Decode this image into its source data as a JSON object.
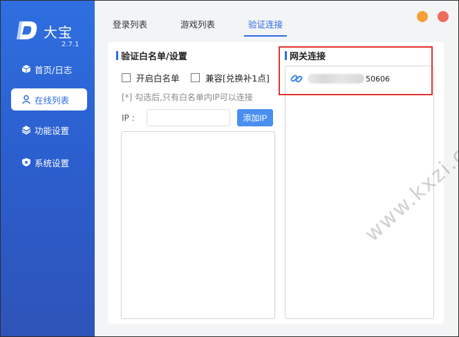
{
  "app": {
    "name": "大宝",
    "version": "2.7.1"
  },
  "sidebar": {
    "items": [
      {
        "label": "首页/日志",
        "icon": "cube-icon",
        "active": false
      },
      {
        "label": "在线列表",
        "icon": "user-icon",
        "active": true
      },
      {
        "label": "功能设置",
        "icon": "layers-icon",
        "active": false
      },
      {
        "label": "系统设置",
        "icon": "shield-icon",
        "active": false
      }
    ]
  },
  "tabs": [
    {
      "label": "登录列表",
      "active": false
    },
    {
      "label": "游戏列表",
      "active": false
    },
    {
      "label": "验证连接",
      "active": true
    }
  ],
  "whitelist": {
    "title": "验证白名单/设置",
    "enable_label": "开启白名单",
    "compat_label": "兼容[兑换补1点]",
    "hint": "[*] 勾选后,只有白名单内IP可以连接",
    "ip_label": "IP :",
    "ip_value": "",
    "add_button": "添加IP"
  },
  "gateway": {
    "title": "网关连接",
    "connection_port": "50606",
    "icon": "link-icon"
  },
  "watermark": "www.kxzi.cn",
  "colors": {
    "accent": "#2b6be0",
    "sidebar": "#2f6fe0",
    "highlight": "#e03030"
  }
}
